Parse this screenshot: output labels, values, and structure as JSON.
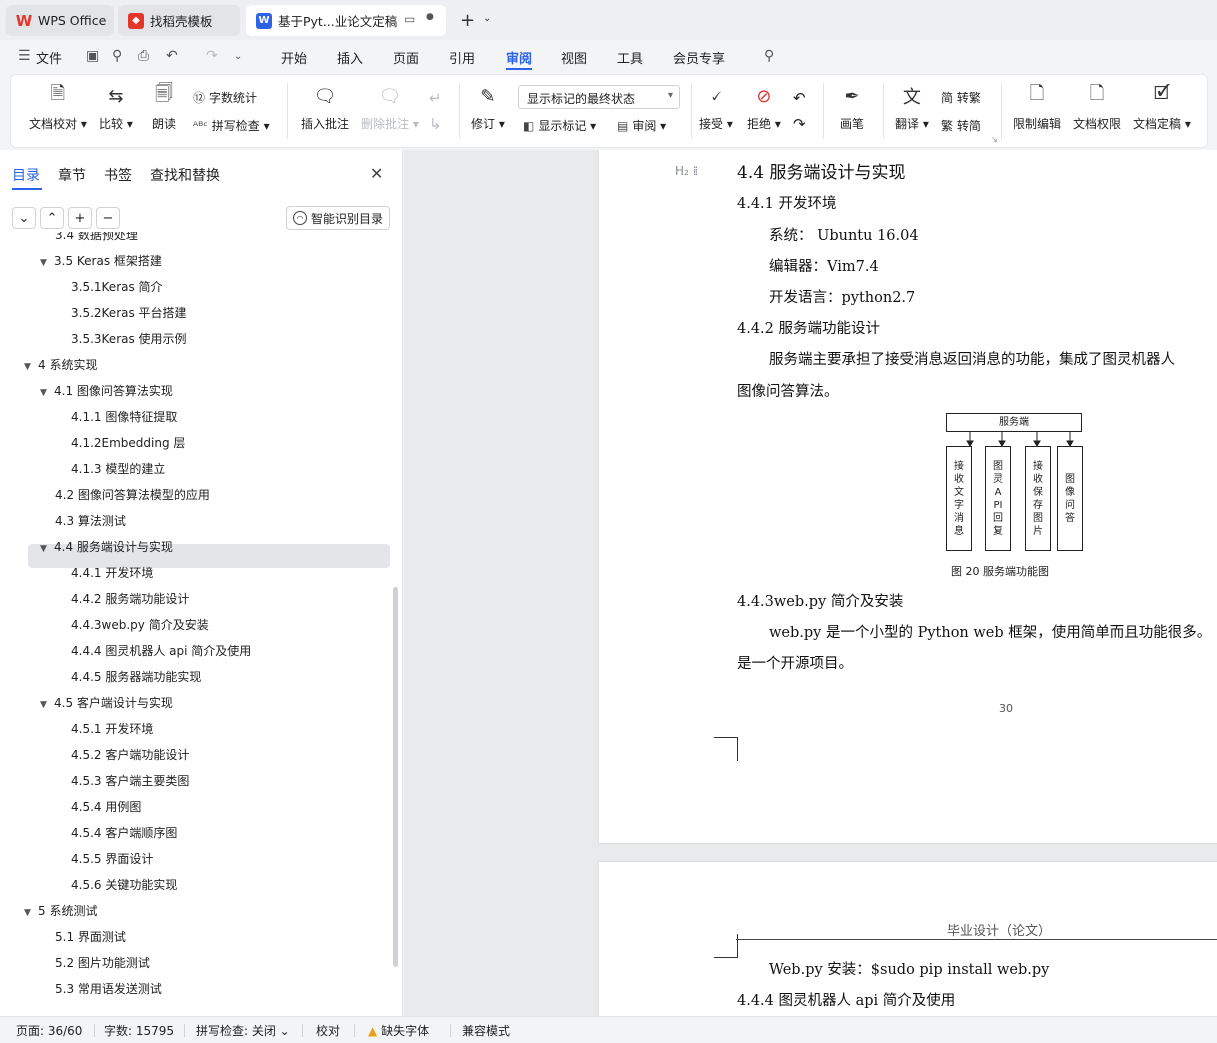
{
  "tabs": [
    {
      "label": "WPS Office",
      "icon": "wps-logo-icon"
    },
    {
      "label": "找稻壳模板",
      "icon": "daoke-icon"
    },
    {
      "label": "基于Pyt...业论文定稿",
      "icon": "writer-w-icon",
      "active": true
    }
  ],
  "menu": {
    "file": "文件",
    "items": [
      "开始",
      "插入",
      "页面",
      "引用",
      "审阅",
      "视图",
      "工具",
      "会员专享"
    ],
    "active": "审阅"
  },
  "ribbon": {
    "proofread": "文档校对",
    "compare": "比较",
    "read_aloud": "朗读",
    "word_count": "字数统计",
    "spell_check": "拼写检查",
    "insert_comment": "插入批注",
    "delete_comment": "删除批注",
    "revise": "修订",
    "display_state": "显示标记的最终状态",
    "show_marks": "显示标记",
    "review": "审阅",
    "accept": "接受",
    "reject": "拒绝",
    "pen": "画笔",
    "translate": "翻译",
    "to_traditional": "简 转繁",
    "to_simplified": "繁 转简",
    "restrict_edit": "限制编辑",
    "doc_permission": "文档权限",
    "doc_finalize": "文档定稿"
  },
  "panel": {
    "tabs": [
      "目录",
      "章节",
      "书签",
      "查找和替换"
    ],
    "smart_toc": "智能识别目录",
    "toc": [
      {
        "label": "3.4 数据预处理",
        "level": 2,
        "arrow": false
      },
      {
        "label": "3.5 Keras 框架搭建",
        "level": 2,
        "arrow": true
      },
      {
        "label": "3.5.1Keras 简介",
        "level": 3,
        "arrow": false
      },
      {
        "label": "3.5.2Keras 平台搭建",
        "level": 3,
        "arrow": false
      },
      {
        "label": "3.5.3Keras 使用示例",
        "level": 3,
        "arrow": false
      },
      {
        "label": "4 系统实现",
        "level": 1,
        "arrow": true
      },
      {
        "label": "4.1 图像问答算法实现",
        "level": 2,
        "arrow": true
      },
      {
        "label": "4.1.1 图像特征提取",
        "level": 3,
        "arrow": false
      },
      {
        "label": "4.1.2Embedding 层",
        "level": 3,
        "arrow": false
      },
      {
        "label": "4.1.3 模型的建立",
        "level": 3,
        "arrow": false
      },
      {
        "label": "4.2 图像问答算法模型的应用",
        "level": 2,
        "arrow": false
      },
      {
        "label": "4.3 算法测试",
        "level": 2,
        "arrow": false
      },
      {
        "label": "4.4 服务端设计与实现",
        "level": 2,
        "arrow": true,
        "selected": true
      },
      {
        "label": "4.4.1 开发环境",
        "level": 3,
        "arrow": false
      },
      {
        "label": "4.4.2 服务端功能设计",
        "level": 3,
        "arrow": false
      },
      {
        "label": "4.4.3web.py 简介及安装",
        "level": 3,
        "arrow": false
      },
      {
        "label": "4.4.4 图灵机器人 api 简介及使用",
        "level": 3,
        "arrow": false
      },
      {
        "label": "4.4.5 服务器端功能实现",
        "level": 3,
        "arrow": false
      },
      {
        "label": "4.5 客户端设计与实现",
        "level": 2,
        "arrow": true
      },
      {
        "label": "4.5.1 开发环境",
        "level": 3,
        "arrow": false
      },
      {
        "label": "4.5.2 客户端功能设计",
        "level": 3,
        "arrow": false
      },
      {
        "label": "4.5.3 客户端主要类图",
        "level": 3,
        "arrow": false
      },
      {
        "label": "4.5.4 用例图",
        "level": 3,
        "arrow": false
      },
      {
        "label": "4.5.4 客户端顺序图",
        "level": 3,
        "arrow": false
      },
      {
        "label": "4.5.5 界面设计",
        "level": 3,
        "arrow": false
      },
      {
        "label": "4.5.6 关键功能实现",
        "level": 3,
        "arrow": false
      },
      {
        "label": "5 系统测试",
        "level": 1,
        "arrow": true
      },
      {
        "label": "5.1 界面测试",
        "level": 2,
        "arrow": false
      },
      {
        "label": "5.2 图片功能测试",
        "level": 2,
        "arrow": false
      },
      {
        "label": "5.3 常用语发送测试",
        "level": 2,
        "arrow": false
      }
    ]
  },
  "doc": {
    "h2_marker": "H₂",
    "heading": "4.4 服务端设计与实现",
    "sub1": "4.4.1 开发环境",
    "env_system": "系统： Ubuntu 16.04",
    "env_editor": "编辑器：Vim7.4",
    "env_lang": "开发语言：python2.7",
    "sub2": "4.4.2 服务端功能设计",
    "para1_line1": "服务端主要承担了接受消息返回消息的功能，集成了图灵机器人",
    "para1_line2": "图像问答算法。",
    "diagram_top": "服务端",
    "diagram_boxes": [
      "接收文字消息",
      "图灵API回复",
      "接收保存图片",
      "图像问答"
    ],
    "fig_caption": "图 20 服务端功能图",
    "sub3": "4.4.3web.py 简介及安装",
    "para2_line1": "web.py 是一个小型的 Python web 框架，使用简单而且功能很多。",
    "para2_line2": "是一个开源项目。",
    "page_number": "30",
    "page2_header": "毕业设计（论文）",
    "install_line": "Web.py 安装：$sudo pip install web.py",
    "sub4": "4.4.4 图灵机器人 api 简介及使用"
  },
  "status": {
    "page": "页面: 36/60",
    "words": "字数: 15795",
    "spell": "拼写检查: 关闭",
    "proof": "校对",
    "missing_font": "缺失字体",
    "compat": "兼容模式"
  },
  "colors": {
    "accent": "#2b62e8",
    "wps_red": "#e5362c"
  }
}
